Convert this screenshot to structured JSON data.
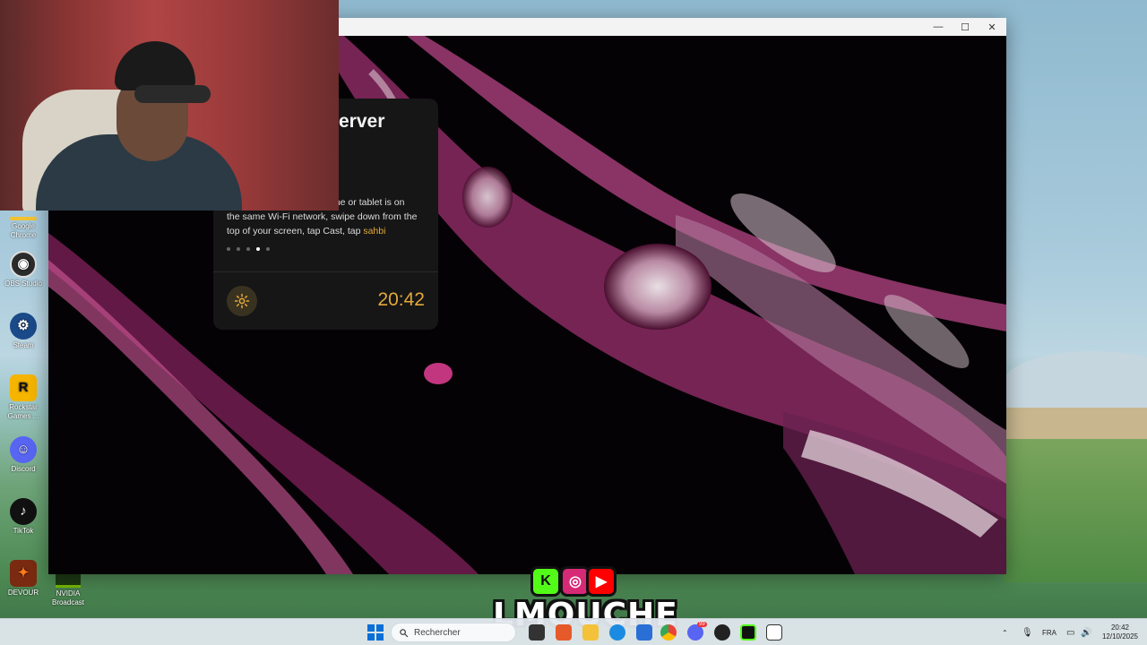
{
  "desktop": {
    "icons": [
      {
        "label": "Google Chrome",
        "icon": "chrome-icon",
        "color": "#f2c230"
      },
      {
        "label": "OBS Studio",
        "icon": "obs-icon",
        "color": "#2b2b2b"
      },
      {
        "label": "Steam",
        "icon": "steam-icon",
        "color": "#1b4a8a"
      },
      {
        "label": "Rockstar Games ...",
        "icon": "rockstar-icon",
        "color": "#f5b400"
      },
      {
        "label": "Discord",
        "icon": "discord-icon",
        "color": "#5865f2"
      },
      {
        "label": "TikTok",
        "icon": "tiktok-icon",
        "color": "#111111"
      },
      {
        "label": "DEVOUR",
        "icon": "devour-icon",
        "color": "#7a2a10"
      }
    ],
    "nvidia_label": "NVIDIA Broadcast"
  },
  "window": {
    "minimize": "—",
    "maximize": "☐",
    "close": "✕"
  },
  "card": {
    "title": "erver",
    "text_line1": "one or tablet is on",
    "text_line2": "the same Wi-Fi network, swipe down from the",
    "text_line3_prefix": "top of your screen, tap Cast, tap ",
    "device_name": "sahbi",
    "dots_total": 5,
    "dots_active": 4,
    "clock": "20:42",
    "accent": "#e3a93a"
  },
  "branding": {
    "name": "LMOUCHE",
    "badges": [
      {
        "icon": "kick-icon",
        "glyph": "K",
        "color": "#53fc18"
      },
      {
        "icon": "instagram-icon",
        "glyph": "◎",
        "color": "#d62976"
      },
      {
        "icon": "youtube-icon",
        "glyph": "▶",
        "color": "#ff0000"
      }
    ]
  },
  "taskbar": {
    "search_placeholder": "Rechercher",
    "language": "FRA",
    "time": "20:42",
    "date": "12/10/2025",
    "discord_badge": "99"
  }
}
